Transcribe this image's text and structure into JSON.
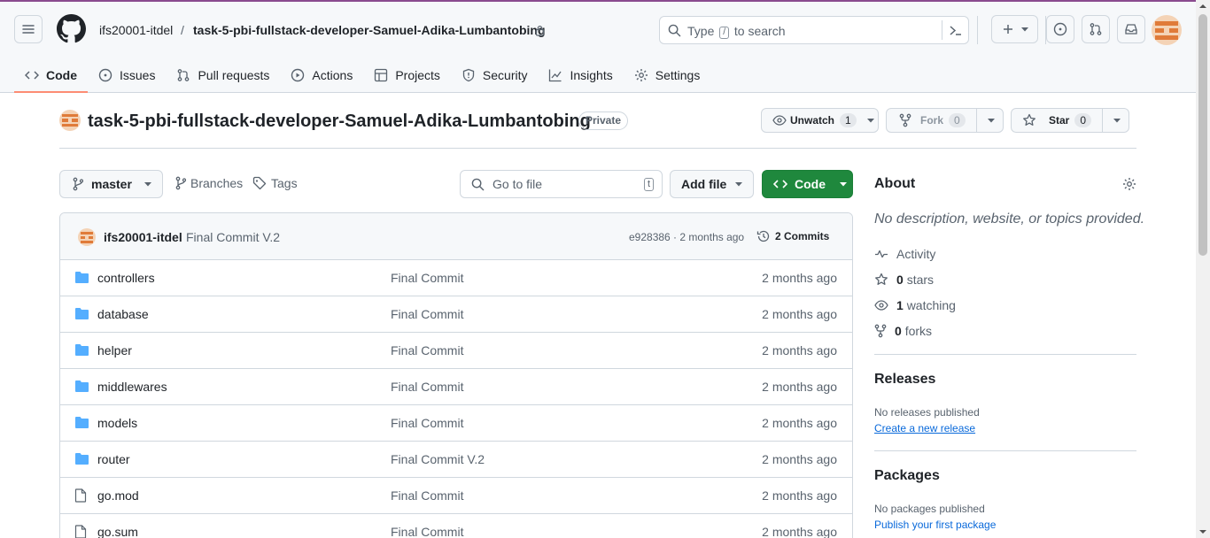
{
  "header": {
    "owner": "ifs20001-itdel",
    "separator": "/",
    "repo": "task-5-pbi-fullstack-developer-Samuel-Adika-Lumbantobing",
    "search_prefix": "Type",
    "search_key": "/",
    "search_suffix": "to search"
  },
  "tabs": [
    {
      "label": "Code",
      "icon": "code-icon"
    },
    {
      "label": "Issues",
      "icon": "issue-icon"
    },
    {
      "label": "Pull requests",
      "icon": "pull-request-icon"
    },
    {
      "label": "Actions",
      "icon": "play-icon"
    },
    {
      "label": "Projects",
      "icon": "table-icon"
    },
    {
      "label": "Security",
      "icon": "shield-icon"
    },
    {
      "label": "Insights",
      "icon": "graph-icon"
    },
    {
      "label": "Settings",
      "icon": "gear-icon"
    }
  ],
  "repo": {
    "title": "task-5-pbi-fullstack-developer-Samuel-Adika-Lumbantobing",
    "visibility": "Private",
    "unwatch_label": "Unwatch",
    "watch_count": "1",
    "fork_label": "Fork",
    "fork_count": "0",
    "star_label": "Star",
    "star_count": "0"
  },
  "toolbar": {
    "branch": "master",
    "branches_label": "Branches",
    "tags_label": "Tags",
    "goto_placeholder": "Go to file",
    "goto_key": "t",
    "add_file_label": "Add file",
    "code_label": "Code"
  },
  "latest_commit": {
    "author": "ifs20001-itdel",
    "message": "Final Commit V.2",
    "hash_age": "e928386 · 2 months ago",
    "commits_label": "2 Commits"
  },
  "files": [
    {
      "name": "controllers",
      "type": "dir",
      "message": "Final Commit",
      "age": "2 months ago"
    },
    {
      "name": "database",
      "type": "dir",
      "message": "Final Commit",
      "age": "2 months ago"
    },
    {
      "name": "helper",
      "type": "dir",
      "message": "Final Commit",
      "age": "2 months ago"
    },
    {
      "name": "middlewares",
      "type": "dir",
      "message": "Final Commit",
      "age": "2 months ago"
    },
    {
      "name": "models",
      "type": "dir",
      "message": "Final Commit",
      "age": "2 months ago"
    },
    {
      "name": "router",
      "type": "dir",
      "message": "Final Commit V.2",
      "age": "2 months ago"
    },
    {
      "name": "go.mod",
      "type": "file",
      "message": "Final Commit",
      "age": "2 months ago"
    },
    {
      "name": "go.sum",
      "type": "file",
      "message": "Final Commit",
      "age": "2 months ago"
    }
  ],
  "about": {
    "heading": "About",
    "description": "No description, website, or topics provided.",
    "activity": "Activity",
    "stars_count": "0",
    "stars_label": "stars",
    "watching_count": "1",
    "watching_label": "watching",
    "forks_count": "0",
    "forks_label": "forks"
  },
  "releases": {
    "heading": "Releases",
    "empty": "No releases published",
    "link": "Create a new release"
  },
  "packages": {
    "heading": "Packages",
    "empty": "No packages published",
    "link": "Publish your first package"
  },
  "colors": {
    "accent_tab": "#fd8c73",
    "code_button": "#1f883d",
    "folder": "#54aeff",
    "link": "#0969da"
  }
}
